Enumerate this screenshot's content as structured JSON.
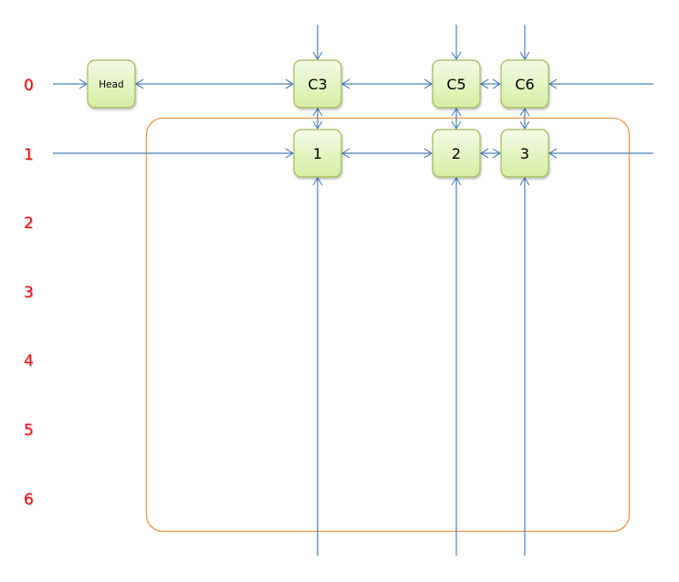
{
  "diagram": {
    "title": "",
    "row_labels": [
      "0",
      "1",
      "2",
      "3",
      "4",
      "5",
      "6"
    ],
    "nodes": [
      {
        "id": "head",
        "label": "Head",
        "row": 0
      },
      {
        "id": "c3",
        "label": "C3",
        "row": 0
      },
      {
        "id": "c5",
        "label": "C5",
        "row": 0
      },
      {
        "id": "c6",
        "label": "C6",
        "row": 0
      },
      {
        "id": "n1",
        "label": "1",
        "row": 1
      },
      {
        "id": "n2",
        "label": "2",
        "row": 1
      },
      {
        "id": "n3",
        "label": "3",
        "row": 1
      }
    ],
    "edges": [
      {
        "from": "left-edge",
        "to": "head",
        "kind": "single"
      },
      {
        "from": "head",
        "to": "c3",
        "kind": "double"
      },
      {
        "from": "c3",
        "to": "c5",
        "kind": "double"
      },
      {
        "from": "c5",
        "to": "c6",
        "kind": "double"
      },
      {
        "from": "right-edge",
        "to": "c6",
        "kind": "single"
      },
      {
        "from": "top-edge",
        "to": "c3",
        "kind": "single"
      },
      {
        "from": "top-edge",
        "to": "c5",
        "kind": "single"
      },
      {
        "from": "top-edge",
        "to": "c6",
        "kind": "single"
      },
      {
        "from": "c3",
        "to": "n1",
        "kind": "double"
      },
      {
        "from": "c5",
        "to": "n2",
        "kind": "double"
      },
      {
        "from": "c6",
        "to": "n3",
        "kind": "double"
      },
      {
        "from": "left-edge",
        "to": "n1",
        "kind": "single"
      },
      {
        "from": "n1",
        "to": "n2",
        "kind": "double"
      },
      {
        "from": "n2",
        "to": "n3",
        "kind": "double"
      },
      {
        "from": "right-edge",
        "to": "n3",
        "kind": "single"
      },
      {
        "from": "bottom-edge",
        "to": "n1",
        "kind": "single"
      },
      {
        "from": "bottom-edge",
        "to": "n2",
        "kind": "single"
      },
      {
        "from": "bottom-edge",
        "to": "n3",
        "kind": "single"
      }
    ],
    "colors": {
      "row_label": "#ff0000",
      "edge": "#4a7ebb",
      "group_border": "#f79646",
      "node_fill_top": "#f4fbe6",
      "node_fill_bottom": "#d7f0a8",
      "node_border": "#9bbb59"
    }
  }
}
